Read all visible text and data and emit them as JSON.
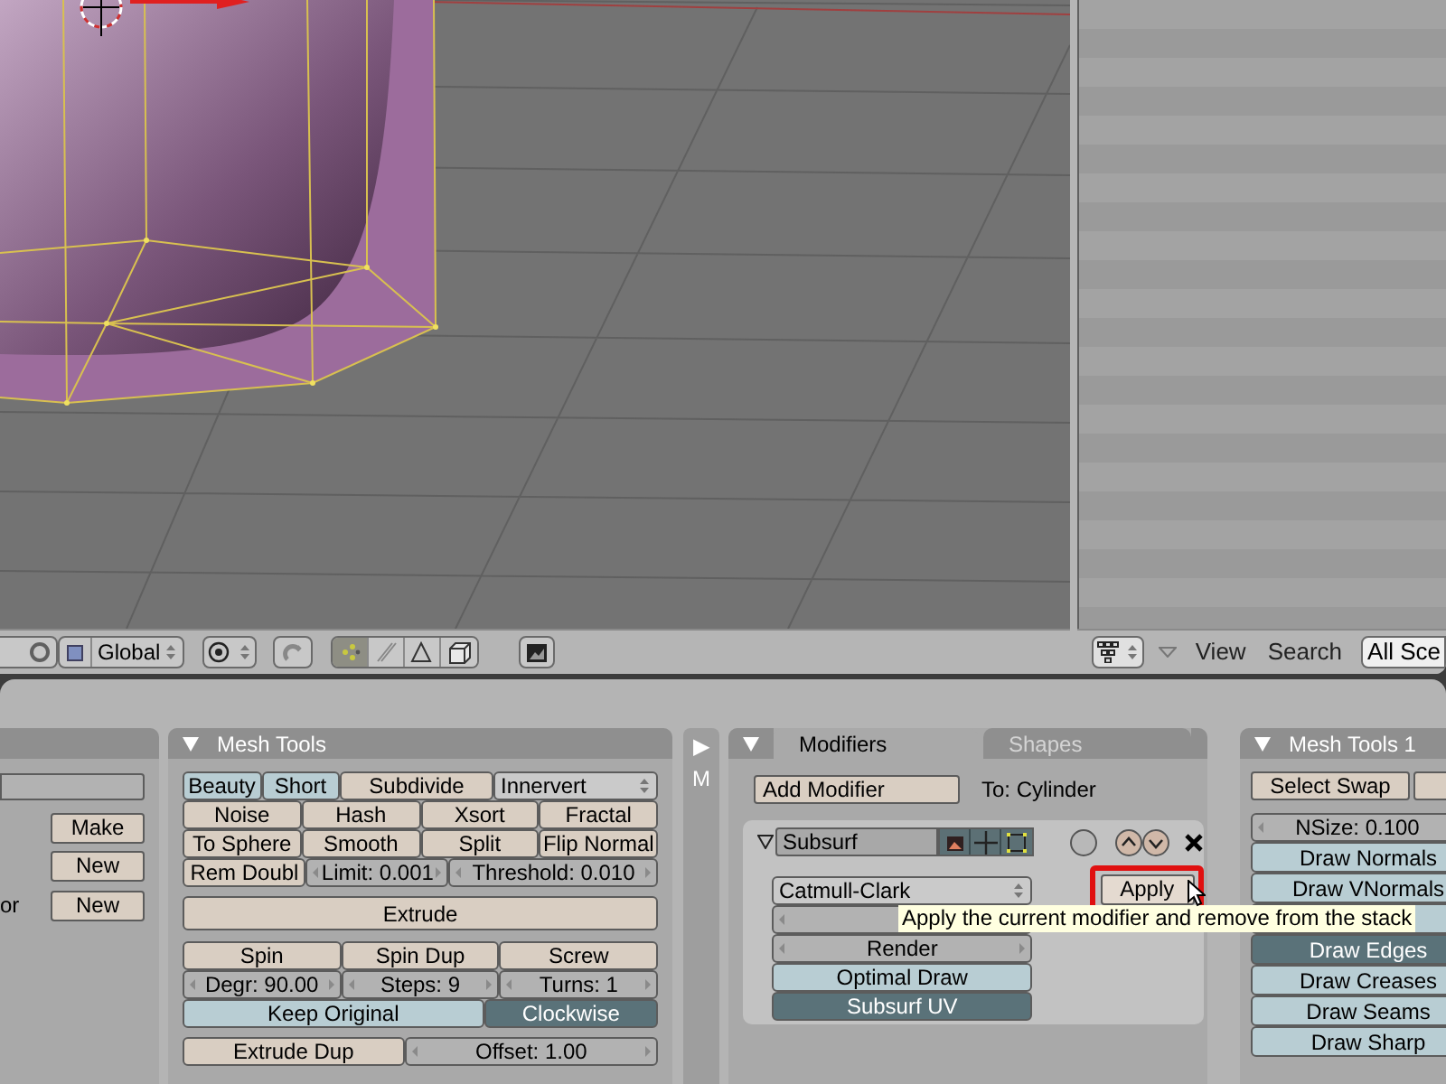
{
  "viewport_header": {
    "orientation": "Global",
    "select_modes": [
      {
        "selected": true
      },
      {
        "selected": false
      },
      {
        "selected": false
      }
    ],
    "occlude": {
      "selected": false
    }
  },
  "outliner_header": {
    "view_menu": "View",
    "search_menu": "Search",
    "scene_field": "All Sce"
  },
  "left_panel": {
    "buttons": [
      "Make",
      "New",
      "New"
    ],
    "label": "or"
  },
  "mesh_tools": {
    "title": "Mesh Tools",
    "rows": [
      [
        {
          "kind": "toggle",
          "label": "Beauty",
          "on": false
        },
        {
          "kind": "toggle",
          "label": "Short",
          "on": false
        },
        {
          "kind": "button",
          "label": "Subdivide"
        },
        {
          "kind": "menu",
          "label": "Innervert"
        }
      ],
      [
        {
          "kind": "button",
          "label": "Noise"
        },
        {
          "kind": "button",
          "label": "Hash"
        },
        {
          "kind": "button",
          "label": "Xsort"
        },
        {
          "kind": "button",
          "label": "Fractal"
        }
      ],
      [
        {
          "kind": "button",
          "label": "To Sphere"
        },
        {
          "kind": "button",
          "label": "Smooth"
        },
        {
          "kind": "button",
          "label": "Split"
        },
        {
          "kind": "button",
          "label": "Flip Normal"
        }
      ],
      [
        {
          "kind": "button",
          "label": "Rem Doubl"
        },
        {
          "kind": "number",
          "label": "Limit: 0.001"
        },
        {
          "kind": "number",
          "label": "Threshold: 0.010"
        }
      ],
      [
        {
          "kind": "button",
          "label": "Extrude"
        }
      ],
      [
        {
          "kind": "button",
          "label": "Spin"
        },
        {
          "kind": "button",
          "label": "Spin Dup"
        },
        {
          "kind": "button",
          "label": "Screw"
        }
      ],
      [
        {
          "kind": "number",
          "label": "Degr: 90.00"
        },
        {
          "kind": "number",
          "label": "Steps: 9"
        },
        {
          "kind": "number",
          "label": "Turns: 1"
        }
      ],
      [
        {
          "kind": "toggle",
          "label": "Keep Original",
          "on": false
        },
        {
          "kind": "toggle",
          "label": "Clockwise",
          "on": true
        }
      ],
      [
        {
          "kind": "button",
          "label": "Extrude Dup"
        },
        {
          "kind": "number",
          "label": "Offset: 1.00"
        }
      ]
    ]
  },
  "side_strip": {
    "arrow": "▶",
    "letter": "M"
  },
  "modifiers_panel": {
    "tabs": [
      {
        "label": "Modifiers",
        "selected": true
      },
      {
        "label": "Shapes",
        "selected": false
      }
    ],
    "add_button": "Add Modifier",
    "target": "To: Cylinder",
    "modifier": {
      "name": "Subsurf",
      "expanded": true,
      "type_menu": "Catmull-Clark",
      "render_levels": "Render",
      "toggles": [
        {
          "label": "Optimal Draw",
          "on": false
        },
        {
          "label": "Subsurf UV",
          "on": true
        }
      ],
      "apply_button": "Apply",
      "apply_highlighted": true
    }
  },
  "mesh_tools_1": {
    "title": "Mesh Tools 1",
    "select_button": "Select Swap",
    "nsize": "NSize: 0.100",
    "toggles": [
      {
        "label": "Draw Normals",
        "on": false
      },
      {
        "label": "Draw VNormals",
        "on": false
      },
      {
        "on": false
      },
      {
        "label": "Draw Edges",
        "on": true
      },
      {
        "label": "Draw Creases",
        "on": false
      },
      {
        "label": "Draw Seams",
        "on": false
      },
      {
        "label": "Draw Sharp",
        "on": false
      }
    ]
  },
  "tooltip": "Apply the current modifier and remove from the stack"
}
